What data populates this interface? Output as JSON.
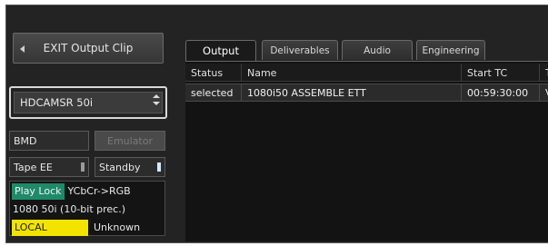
{
  "left_panel": {
    "exit_button_label": "EXIT Output Clip",
    "deck_format": "HDCAMSR 50i",
    "bmd_label": "BMD",
    "emulator_label": "Emulator",
    "tape_ee_label": "Tape EE",
    "standby_label": "Standby",
    "status": {
      "play_lock": "Play Lock",
      "color_space": "YCbCr->RGB",
      "format_info": "1080 50i (10-bit prec.)",
      "local": "LOCAL",
      "unknown": "Unknown"
    }
  },
  "tabs": [
    {
      "label": "Output",
      "active": true
    },
    {
      "label": "Deliverables",
      "active": false
    },
    {
      "label": "Audio",
      "active": false
    },
    {
      "label": "Engineering",
      "active": false
    }
  ],
  "table": {
    "columns": [
      "Status",
      "Name",
      "Start TC",
      "T"
    ],
    "rows": [
      {
        "status": "selected",
        "name": "1080i50 ASSEMBLE ETT",
        "start_tc": "00:59:30:00",
        "extra": "V"
      }
    ]
  },
  "colors": {
    "play_lock_green": "#1e8a68",
    "local_yellow": "#f2e400",
    "panel_bg": "#232323"
  }
}
